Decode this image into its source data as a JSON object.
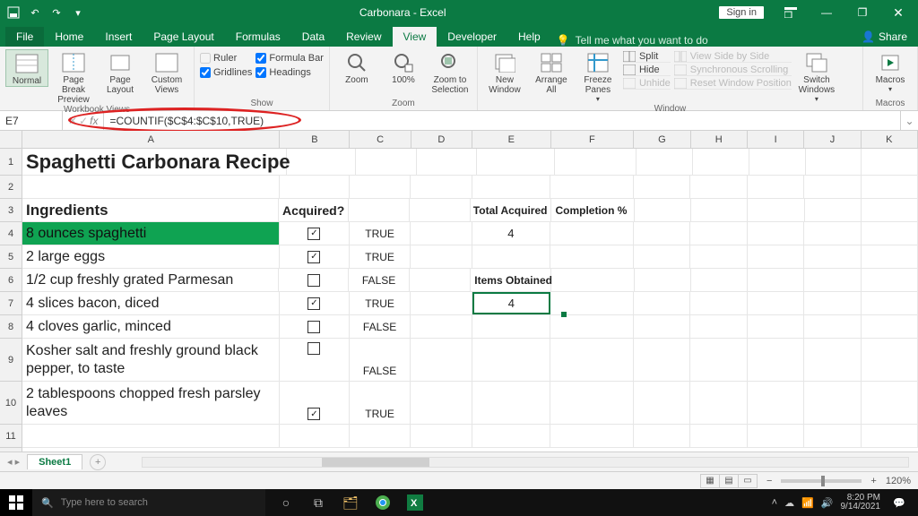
{
  "titlebar": {
    "doc_title": "Carbonara - Excel",
    "signin": "Sign in"
  },
  "tabs": {
    "file": "File",
    "home": "Home",
    "insert": "Insert",
    "page_layout": "Page Layout",
    "formulas": "Formulas",
    "data": "Data",
    "review": "Review",
    "view": "View",
    "developer": "Developer",
    "help": "Help",
    "tellme": "Tell me what you want to do",
    "share": "Share"
  },
  "ribbon": {
    "workbook_views": {
      "label": "Workbook Views",
      "normal": "Normal",
      "page_break": "Page Break Preview",
      "page_layout": "Page Layout",
      "custom": "Custom Views"
    },
    "show": {
      "label": "Show",
      "ruler": "Ruler",
      "gridlines": "Gridlines",
      "formulabar": "Formula Bar",
      "headings": "Headings"
    },
    "zoom": {
      "label": "Zoom",
      "zoom": "Zoom",
      "hundred": "100%",
      "to_sel": "Zoom to Selection"
    },
    "window": {
      "label": "Window",
      "new": "New Window",
      "arrange": "Arrange All",
      "freeze": "Freeze Panes",
      "split": "Split",
      "hide": "Hide",
      "unhide": "Unhide",
      "sidebyside": "View Side by Side",
      "sync": "Synchronous Scrolling",
      "reset": "Reset Window Position",
      "switch": "Switch Windows"
    },
    "macros": {
      "label": "Macros",
      "macros": "Macros"
    }
  },
  "formula_bar": {
    "cell": "E7",
    "formula": "=COUNTIF($C$4:$C$10,TRUE)",
    "fx": "fx"
  },
  "columns": [
    "A",
    "B",
    "C",
    "D",
    "E",
    "F",
    "G",
    "H",
    "I",
    "J",
    "K"
  ],
  "rows": {
    "r1": {
      "A": "Spaghetti Carbonara Recipe"
    },
    "r3": {
      "A": "Ingredients",
      "B": "Acquired?",
      "E": "Total Acquired",
      "F": "Completion %"
    },
    "r4": {
      "A": "8 ounces spaghetti",
      "B_checked": true,
      "C": "TRUE",
      "E": "4"
    },
    "r5": {
      "A": "2 large eggs",
      "B_checked": true,
      "C": "TRUE"
    },
    "r6": {
      "A": "1/2 cup freshly grated Parmesan",
      "B_checked": false,
      "C": "FALSE",
      "E": "Items Obtained"
    },
    "r7": {
      "A": "4 slices bacon, diced",
      "B_checked": true,
      "C": "TRUE",
      "E": "4"
    },
    "r8": {
      "A": "4 cloves garlic, minced",
      "B_checked": false,
      "C": "FALSE"
    },
    "r9": {
      "A": "Kosher salt and freshly ground black pepper, to taste",
      "B_checked": false,
      "C": "FALSE"
    },
    "r10": {
      "A": "2 tablespoons chopped fresh parsley leaves",
      "B_checked": true,
      "C": "TRUE"
    }
  },
  "sheettabs": {
    "sheet1": "Sheet1"
  },
  "status": {
    "zoom": "120%"
  },
  "taskbar": {
    "search_placeholder": "Type here to search",
    "time": "8:20 PM",
    "date": "9/14/2021"
  }
}
